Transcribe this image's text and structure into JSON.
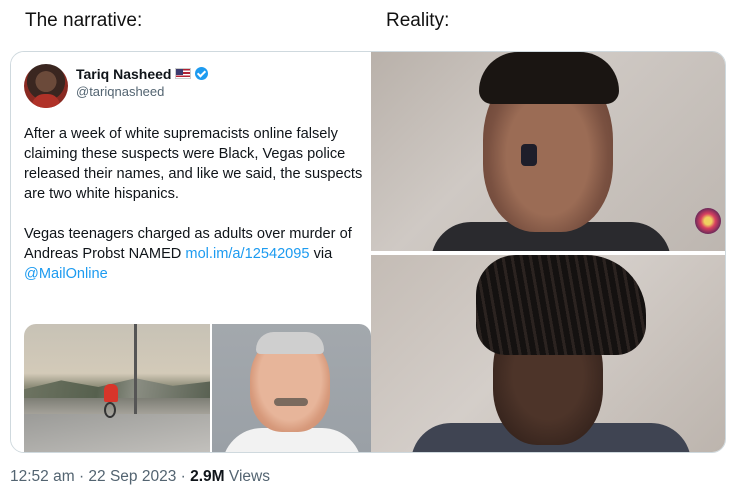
{
  "labels": {
    "left": "The narrative:",
    "right": "Reality:"
  },
  "tweet": {
    "author_name": "Tariq Nasheed",
    "author_handle": "@tariqnasheed",
    "paragraph_1": "After a week of white supremacists online falsely claiming these suspects were Black, Vegas police released their names, and like we said, the suspects are two white hispanics.",
    "paragraph_2_text": "Vegas teenagers charged as adults over murder of Andreas Probst NAMED ",
    "paragraph_2_link": "mol.im/a/12542095",
    "paragraph_2_via": " via ",
    "paragraph_2_mention": "@MailOnline",
    "icons": [
      "us-flag-icon",
      "verified-badge-icon"
    ]
  },
  "footer": {
    "time": "12:52 am",
    "separator_1": " · ",
    "date": "22 Sep 2023",
    "separator_2": " · ",
    "views_count": "2.9M",
    "views_label": " Views"
  },
  "colors": {
    "text": "#0f1419",
    "muted": "#536471",
    "link": "#1d9bf0",
    "border": "#cfd9de"
  }
}
